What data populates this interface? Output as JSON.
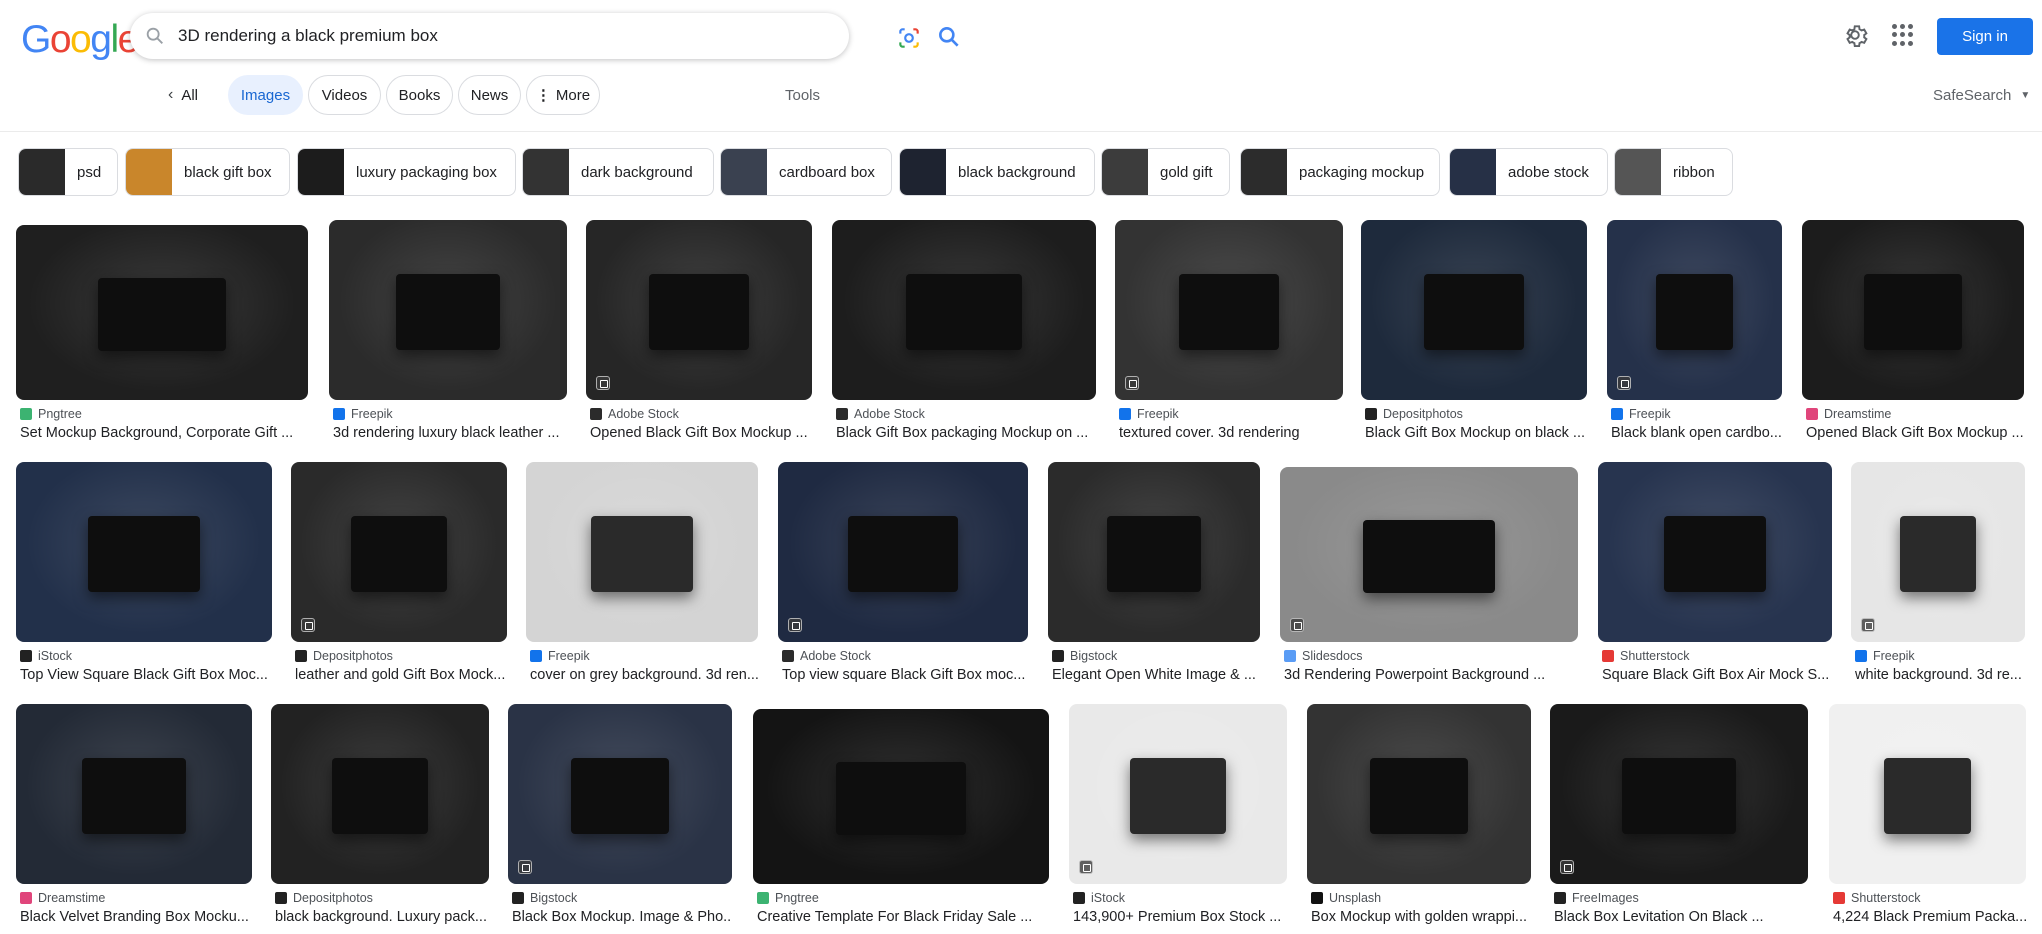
{
  "logo": "Google",
  "search": {
    "query": "3D rendering a black premium box",
    "icons": [
      "search-icon",
      "lens-icon",
      "magnifier-icon"
    ]
  },
  "header": {
    "settings_icon": "gear-icon",
    "apps_icon": "apps-grid-icon",
    "sign_in": "Sign in"
  },
  "tabs": {
    "all": "All",
    "items": [
      "Images",
      "Videos",
      "Books",
      "News",
      "More"
    ],
    "active": "Images",
    "tools": "Tools",
    "safesearch": "SafeSearch"
  },
  "chips": [
    {
      "label": "psd",
      "thumb": "#2a2a2a"
    },
    {
      "label": "black gift box",
      "thumb": "#c9862b"
    },
    {
      "label": "luxury packaging box",
      "thumb": "#1c1c1c"
    },
    {
      "label": "dark background",
      "thumb": "#333333"
    },
    {
      "label": "cardboard box",
      "thumb": "#3a4150"
    },
    {
      "label": "black background",
      "thumb": "#1e2330"
    },
    {
      "label": "gold gift",
      "thumb": "#3c3c3c"
    },
    {
      "label": "packaging mockup",
      "thumb": "#2c2c2c"
    },
    {
      "label": "adobe stock",
      "thumb": "#263046"
    },
    {
      "label": "ribbon",
      "thumb": "#555555"
    }
  ],
  "results": [
    {
      "source": "Pngtree",
      "title": "Set Mockup Background, Corporate Gift ...",
      "fav": "#3cb371",
      "img": "#1f1f1f"
    },
    {
      "source": "Freepik",
      "title": "3d rendering luxury black leather ...",
      "fav": "#1273eb",
      "img": "#2b2b2b"
    },
    {
      "source": "Adobe Stock",
      "title": "Opened Black Gift Box Mockup ...",
      "fav": "#2b2b2b",
      "img": "#262626"
    },
    {
      "source": "Adobe Stock",
      "title": "Black Gift Box packaging Mockup on ...",
      "fav": "#2b2b2b",
      "img": "#1d1d1d"
    },
    {
      "source": "Freepik",
      "title": "textured cover. 3d rendering",
      "fav": "#1273eb",
      "img": "#333333"
    },
    {
      "source": "Depositphotos",
      "title": "Black Gift Box Mockup on black ...",
      "fav": "#222222",
      "img": "#1e2a3c"
    },
    {
      "source": "Freepik",
      "title": "Black blank open cardbo...",
      "fav": "#1273eb",
      "img": "#25314a"
    },
    {
      "source": "Dreamstime",
      "title": "Opened Black Gift Box Mockup ...",
      "fav": "#e0457b",
      "img": "#1c1c1c"
    },
    {
      "source": "iStock",
      "title": "Top View Square Black Gift Box Moc...",
      "fav": "#222222",
      "img": "#22304a"
    },
    {
      "source": "Depositphotos",
      "title": "leather and gold Gift Box Mock...",
      "fav": "#222222",
      "img": "#2a2a2a"
    },
    {
      "source": "Freepik",
      "title": "cover on grey background. 3d ren...",
      "fav": "#1273eb",
      "img": "#d4d4d4"
    },
    {
      "source": "Adobe Stock",
      "title": "Top view square Black Gift Box moc...",
      "fav": "#2b2b2b",
      "img": "#1f2a42"
    },
    {
      "source": "Bigstock",
      "title": "Elegant Open White Image & ...",
      "fav": "#222222",
      "img": "#2b2b2b"
    },
    {
      "source": "Slidesdocs",
      "title": "3d Rendering Powerpoint Background ...",
      "fav": "#5a9cf5",
      "img": "#8a8a8a"
    },
    {
      "source": "Shutterstock",
      "title": "Square Black Gift Box Air Mock S...",
      "fav": "#e53935",
      "img": "#27344f"
    },
    {
      "source": "Freepik",
      "title": "white background. 3d re...",
      "fav": "#1273eb",
      "img": "#e6e6e6"
    },
    {
      "source": "Dreamstime",
      "title": "Black Velvet Branding Box Mocku...",
      "fav": "#e0457b",
      "img": "#232a36"
    },
    {
      "source": "Depositphotos",
      "title": "black background. Luxury pack...",
      "fav": "#222222",
      "img": "#222222"
    },
    {
      "source": "Bigstock",
      "title": "Black Box Mockup. Image & Pho...",
      "fav": "#222222",
      "img": "#2a3346"
    },
    {
      "source": "Pngtree",
      "title": "Creative Template For Black Friday Sale ...",
      "fav": "#3cb371",
      "img": "#141414"
    },
    {
      "source": "iStock",
      "title": "143,900+ Premium Box Stock ...",
      "fav": "#222222",
      "img": "#e9e9e9"
    },
    {
      "source": "Unsplash",
      "title": "Box Mockup with golden wrappi...",
      "fav": "#111111",
      "img": "#333333"
    },
    {
      "source": "FreeImages",
      "title": "Black Box Levitation On Black ...",
      "fav": "#222222",
      "img": "#1a1a1a"
    },
    {
      "source": "Shutterstock",
      "title": "4,224 Black Premium Packa...",
      "fav": "#e53935",
      "img": "#f0f0f0"
    }
  ]
}
